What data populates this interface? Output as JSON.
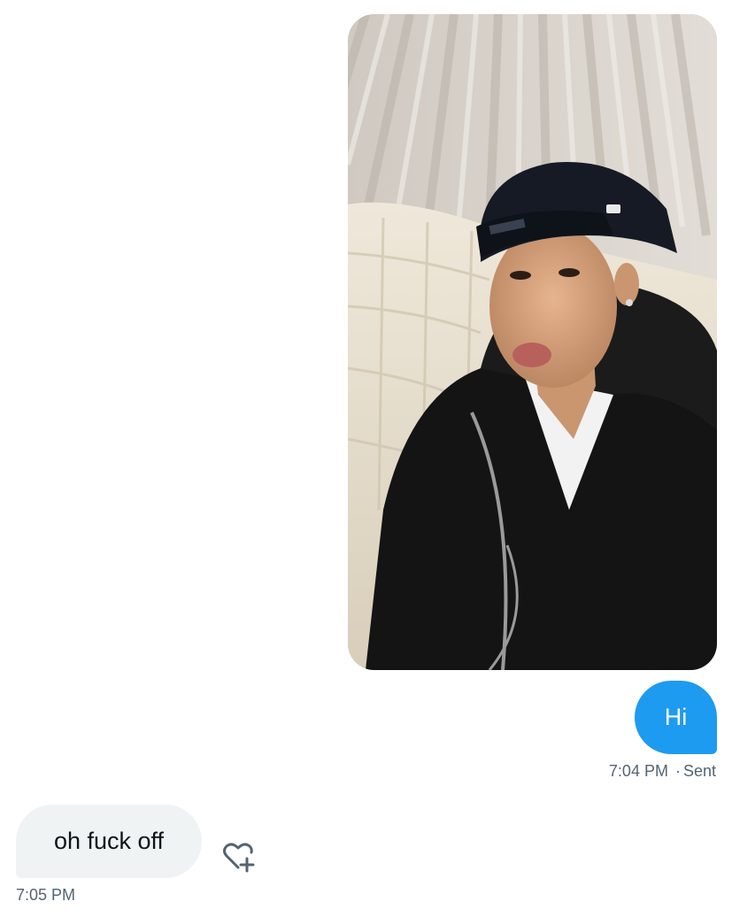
{
  "messages": {
    "sent_photo": {
      "alt": "photo"
    },
    "sent_text": {
      "text": "Hi",
      "time": "7:04 PM",
      "dot": "·",
      "status": "Sent"
    },
    "received_text": {
      "text": "oh fuck off",
      "time": "7:05 PM"
    }
  },
  "icons": {
    "react": "heart-plus-icon"
  },
  "colors": {
    "sent_bubble": "#1d9bf0",
    "received_bubble": "#eff3f4",
    "meta_text": "#536471",
    "text": "#0f1419"
  }
}
